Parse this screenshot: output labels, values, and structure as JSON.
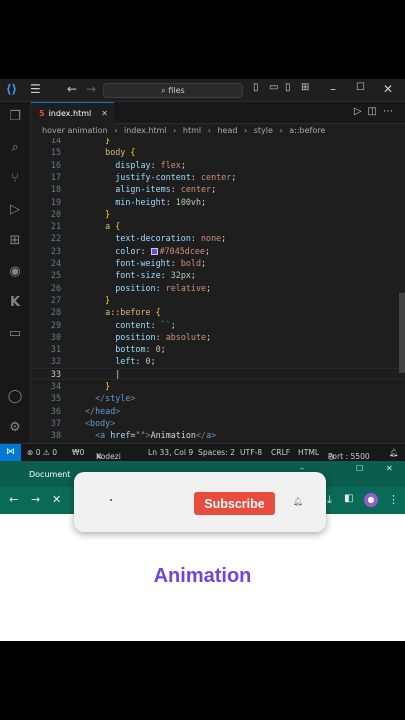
{
  "vscode": {
    "titlebar": {
      "search_text": "files",
      "icons": [
        "vscode-logo-icon",
        "menu-icon",
        "back-arrow-icon",
        "forward-arrow-icon",
        "search-icon",
        "layout-sidebar-icon",
        "layout-panel-icon",
        "layout-secondary-icon",
        "layout-custom-icon",
        "minimize-icon",
        "maximize-icon",
        "close-icon"
      ]
    },
    "activity_bar": [
      "explorer-icon",
      "search-icon",
      "source-control-icon",
      "run-debug-icon",
      "extensions-icon",
      "github-icon",
      "kodezi-icon",
      "chat-icon",
      "account-icon",
      "settings-gear-icon"
    ],
    "tab": {
      "label": "index.html",
      "close": "✕"
    },
    "breadcrumbs": [
      "hover animation",
      "index.html",
      "html",
      "head",
      "style",
      "a::before"
    ],
    "line_numbers": [
      "14",
      "15",
      "16",
      "17",
      "18",
      "19",
      "20",
      "21",
      "22",
      "23",
      "24",
      "25",
      "26",
      "27",
      "28",
      "29",
      "30",
      "31",
      "32",
      "33",
      "34",
      "35",
      "36",
      "37",
      "38"
    ],
    "current_line": "33",
    "code": [
      [
        [
          "t-brk",
          "    }"
        ]
      ],
      [
        [
          "t-sel",
          "    body "
        ],
        [
          "t-brk",
          "{"
        ]
      ],
      [
        [
          "t-prop",
          "      display"
        ],
        [
          "t-txt",
          ": "
        ],
        [
          "t-val",
          "flex"
        ],
        [
          "t-txt",
          ";"
        ]
      ],
      [
        [
          "t-prop",
          "      justify-content"
        ],
        [
          "t-txt",
          ": "
        ],
        [
          "t-val",
          "center"
        ],
        [
          "t-txt",
          ";"
        ]
      ],
      [
        [
          "t-prop",
          "      align-items"
        ],
        [
          "t-txt",
          ": "
        ],
        [
          "t-val",
          "center"
        ],
        [
          "t-txt",
          ";"
        ]
      ],
      [
        [
          "t-prop",
          "      min-height"
        ],
        [
          "t-txt",
          ": "
        ],
        [
          "t-num",
          "100vh"
        ],
        [
          "t-txt",
          ";"
        ]
      ],
      [
        [
          "t-brk",
          "    }"
        ]
      ],
      [
        [
          "t-sel",
          "    a "
        ],
        [
          "t-brk",
          "{"
        ]
      ],
      [
        [
          "t-prop",
          "      text-decoration"
        ],
        [
          "t-txt",
          ": "
        ],
        [
          "t-val",
          "none"
        ],
        [
          "t-txt",
          ";"
        ]
      ],
      [
        [
          "t-prop",
          "      color"
        ],
        [
          "t-txt",
          ": "
        ],
        [
          "swatch",
          ""
        ],
        [
          "t-val",
          "#7045dcee"
        ],
        [
          "t-txt",
          ";"
        ]
      ],
      [
        [
          "t-prop",
          "      font-weight"
        ],
        [
          "t-txt",
          ": "
        ],
        [
          "t-val",
          "bold"
        ],
        [
          "t-txt",
          ";"
        ]
      ],
      [
        [
          "t-prop",
          "      font-size"
        ],
        [
          "t-txt",
          ": "
        ],
        [
          "t-num",
          "32px"
        ],
        [
          "t-txt",
          ";"
        ]
      ],
      [
        [
          "t-prop",
          "      position"
        ],
        [
          "t-txt",
          ": "
        ],
        [
          "t-val",
          "relative"
        ],
        [
          "t-txt",
          ";"
        ]
      ],
      [
        [
          "t-brk",
          "    }"
        ]
      ],
      [
        [
          "t-sel",
          "    a::before "
        ],
        [
          "t-brk",
          "{"
        ]
      ],
      [
        [
          "t-prop",
          "      content"
        ],
        [
          "t-txt",
          ": "
        ],
        [
          "t-str",
          "``"
        ],
        [
          "t-txt",
          ";"
        ]
      ],
      [
        [
          "t-prop",
          "      position"
        ],
        [
          "t-txt",
          ": "
        ],
        [
          "t-val",
          "absolute"
        ],
        [
          "t-txt",
          ";"
        ]
      ],
      [
        [
          "t-prop",
          "      bottom"
        ],
        [
          "t-txt",
          ": "
        ],
        [
          "t-num",
          "0"
        ],
        [
          "t-txt",
          ";"
        ]
      ],
      [
        [
          "t-prop",
          "      left"
        ],
        [
          "t-txt",
          ": "
        ],
        [
          "t-num",
          "0"
        ],
        [
          "t-txt",
          ";"
        ]
      ],
      [
        [
          "t-txt",
          "      |"
        ]
      ],
      [
        [
          "t-brk",
          "    }"
        ]
      ],
      [
        [
          "t-pun",
          "  </"
        ],
        [
          "t-tag",
          "style"
        ],
        [
          "t-pun",
          ">"
        ]
      ],
      [
        [
          "t-pun",
          "</"
        ],
        [
          "t-tag",
          "head"
        ],
        [
          "t-pun",
          ">"
        ]
      ],
      [
        [
          "t-pun",
          "<"
        ],
        [
          "t-tag",
          "body"
        ],
        [
          "t-pun",
          ">"
        ]
      ],
      [
        [
          "t-pun",
          "  <"
        ],
        [
          "t-tag",
          "a"
        ],
        [
          "t-prop",
          " href"
        ],
        [
          "t-txt",
          "="
        ],
        [
          "t-str",
          "\"\""
        ],
        [
          "t-pun",
          ">"
        ],
        [
          "t-txt",
          "Animation"
        ],
        [
          "t-pun",
          "</"
        ],
        [
          "t-tag",
          "a"
        ],
        [
          "t-pun",
          ">"
        ]
      ]
    ],
    "status": {
      "errors": "⊗ 0 ⚠ 0",
      "ports": "₩0",
      "kodezi": "Kodezi",
      "position": "Ln 33, Col 9",
      "spaces": "Spaces: 2",
      "encoding": "UTF-8",
      "eol": "CRLF",
      "language": "HTML",
      "port": "Port : 5500"
    }
  },
  "browser": {
    "tab_title": "Document",
    "toolbar_icons": [
      "back-icon",
      "forward-icon",
      "stop-icon",
      "download-icon",
      "sidebar-icon",
      "profile-avatar",
      "more-icon"
    ],
    "page_heading": "Animation",
    "accent": "#7045dc"
  },
  "overlay": {
    "subscribe_label": "Subscribe",
    "bell": "🔔"
  }
}
